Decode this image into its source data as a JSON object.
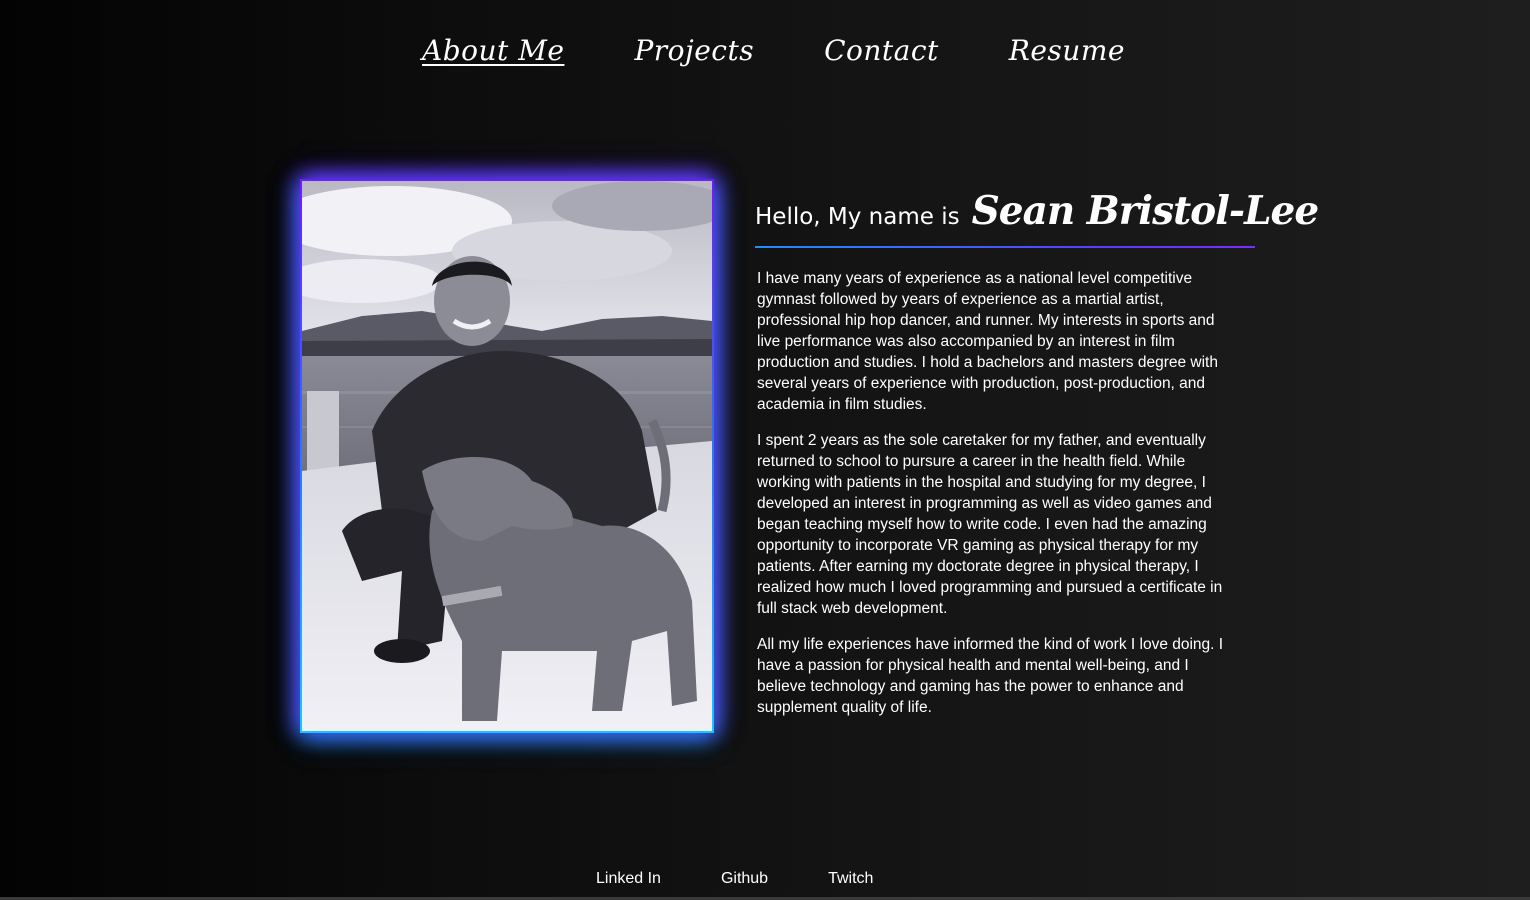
{
  "nav": {
    "items": [
      {
        "label": "About  Me",
        "active": true
      },
      {
        "label": "Projects",
        "active": false
      },
      {
        "label": "Contact",
        "active": false
      },
      {
        "label": "Resume",
        "active": false
      }
    ]
  },
  "profile": {
    "greeting": "Hello, My name is",
    "name": "Sean Bristol-Lee",
    "photo_icon": "profile-photo",
    "paragraphs": [
      "I have many years of experience as a national level competitive gymnast followed by years of experience as a martial artist, professional hip hop dancer, and runner. My interests in sports and live performance was also accompanied by an interest in film production and studies. I hold a bachelors and masters degree with several years of experience with production, post-production, and academia in film studies.",
      "I spent 2 years as the sole caretaker for my father, and eventually returned to school to pursure a career in the health field. While working with patients in the hospital and studying for my degree, I developed an interest in programming as well as video games and began teaching myself how to write code. I even had the amazing opportunity to incorporate VR gaming as physical therapy for my patients. After earning my doctorate degree in physical therapy, I realized how much I loved programming and pursued a certificate in full stack web development.",
      "All my life experiences have informed the kind of work I love doing. I have a passion for physical health and mental well-being, and I believe technology and gaming has the power to enhance and supplement quality of life."
    ]
  },
  "footer": {
    "links": [
      "Linked In",
      "Github",
      "Twitch"
    ]
  },
  "colors": {
    "glow_top": "#6a1fff",
    "glow_bottom": "#18c6ff",
    "background": "#0d0d0d"
  }
}
